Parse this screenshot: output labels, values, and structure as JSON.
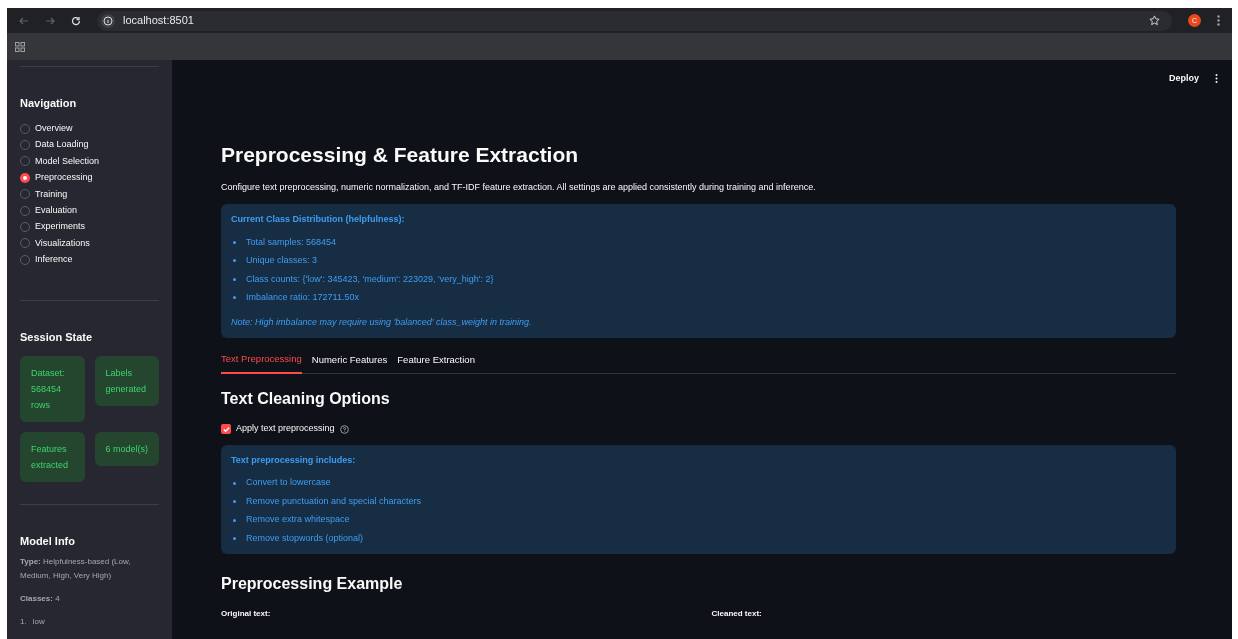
{
  "browser": {
    "url": "localhost:8501",
    "avatar": "C"
  },
  "sidebar": {
    "nav_title": "Navigation",
    "nav_items": [
      {
        "label": "Overview",
        "selected": false
      },
      {
        "label": "Data Loading",
        "selected": false
      },
      {
        "label": "Model Selection",
        "selected": false
      },
      {
        "label": "Preprocessing",
        "selected": true
      },
      {
        "label": "Training",
        "selected": false
      },
      {
        "label": "Evaluation",
        "selected": false
      },
      {
        "label": "Experiments",
        "selected": false
      },
      {
        "label": "Visualizations",
        "selected": false
      },
      {
        "label": "Inference",
        "selected": false
      }
    ],
    "session_title": "Session State",
    "session_cards": [
      "Dataset: 568454 rows",
      "Labels generated",
      "Features extracted",
      "6 model(s)"
    ],
    "model_info_title": "Model Info",
    "model_info": [
      "**Type:** Helpfulness-based (Low, Medium, High, Very High)",
      "**Classes:** 4"
    ],
    "classes": [
      {
        "number": "1.",
        "label": "low"
      }
    ]
  },
  "header": {
    "deploy": "Deploy"
  },
  "main": {
    "title": "Preprocessing & Feature Extraction",
    "description": "Configure text preprocessing, numeric normalization, and TF-IDF feature extraction. All settings are applied consistently during training and inference.",
    "distribution": {
      "title": "Current Class Distribution (helpfulness):",
      "items": [
        "Total samples: 568454",
        "Unique classes: 3",
        "Class counts: {'low': 345423, 'medium': 223029, 'very_high': 2}",
        "Imbalance ratio: 172711.50x"
      ],
      "note": "Note: High imbalance may require using 'balanced' class_weight in training."
    },
    "tabs": [
      {
        "label": "Text Preprocessing",
        "selected": true
      },
      {
        "label": "Numeric Features",
        "selected": false
      },
      {
        "label": "Feature Extraction",
        "selected": false
      }
    ],
    "section_title": "Text Cleaning Options",
    "checkbox": {
      "label": "Apply text preprocessing",
      "checked": true
    },
    "includes": {
      "title": "Text preprocessing includes:",
      "items": [
        "Convert to lowercase",
        "Remove punctuation and special characters",
        "Remove extra whitespace",
        "Remove stopwords (optional)"
      ]
    },
    "example_title": "Preprocessing Example",
    "original_label": "Original text:",
    "cleaned_label": "Cleaned text:"
  }
}
